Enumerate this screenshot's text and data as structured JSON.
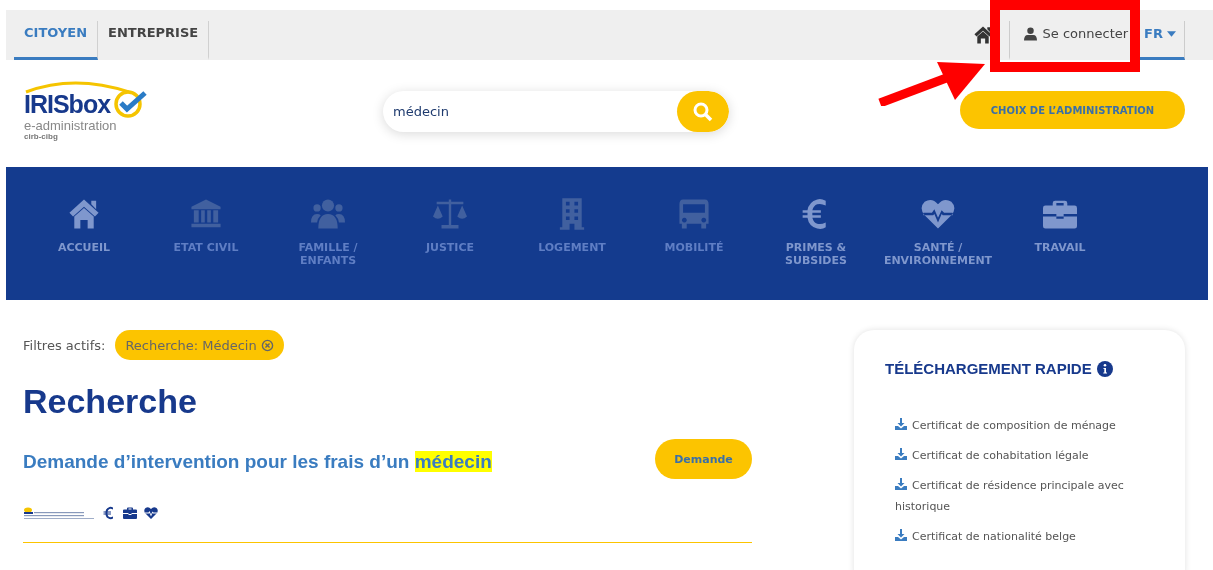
{
  "top_bar": {
    "tabs": [
      {
        "label": "CITOYEN",
        "selected": true
      },
      {
        "label": "ENTREPRISE",
        "selected": false
      }
    ],
    "login": "Se connecter",
    "language": {
      "label": "FR",
      "selected": true
    }
  },
  "header": {
    "logo": {
      "name": "IRISbox",
      "subtitle": "e-administration",
      "org": "cirb-cibg"
    },
    "search": {
      "value": "médecin"
    },
    "admin_button": "CHOIX DE L’ADMINISTRATION"
  },
  "nav": [
    {
      "kind": "home",
      "label": "ACCUEIL",
      "dimmed": false
    },
    {
      "kind": "bank",
      "label": "ETAT CIVIL",
      "dimmed": true
    },
    {
      "kind": "family",
      "label": "FAMILLE / ENFANTS",
      "dimmed": true
    },
    {
      "kind": "scale",
      "label": "JUSTICE",
      "dimmed": true
    },
    {
      "kind": "building",
      "label": "LOGEMENT",
      "dimmed": true
    },
    {
      "kind": "bus",
      "label": "MOBILITÉ",
      "dimmed": true
    },
    {
      "kind": "euro",
      "label": "PRIMES & SUBSIDES",
      "dimmed": false
    },
    {
      "kind": "heart",
      "label": "SANTÉ / ENVIRONNEMENT",
      "dimmed": false
    },
    {
      "kind": "briefcase",
      "label": "TRAVAIL",
      "dimmed": false
    }
  ],
  "filters": {
    "label": "Filtres actifs:",
    "chips": [
      "Recherche: Médecin"
    ]
  },
  "page_title": "Recherche",
  "results": [
    {
      "title": "Demande d’intervention pour les frais d’un",
      "highlight": "médecin",
      "button": "Demande",
      "tags": [
        {
          "kind": "euro"
        },
        {
          "kind": "briefcase"
        },
        {
          "kind": "heart"
        }
      ]
    }
  ],
  "quick_download": {
    "title": "TÉLÉCHARGEMENT RAPIDE",
    "items": [
      "Certificat de composition de ménage",
      "Certificat de cohabitation légale",
      "Certificat de résidence principale avec historique",
      "Certificat de nationalité belge"
    ]
  }
}
